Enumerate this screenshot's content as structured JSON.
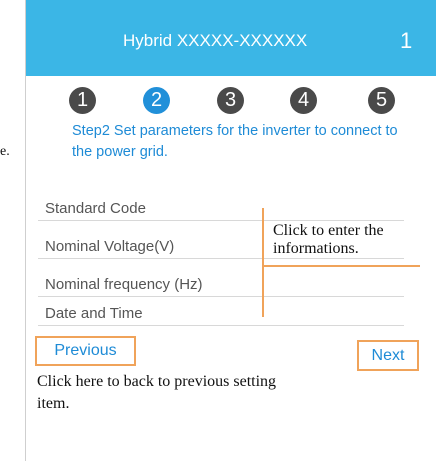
{
  "left_fragment": "e.",
  "header": {
    "title": "Hybrid XXXXX-XXXXXX",
    "page_number": "1"
  },
  "steps": [
    {
      "label": "1",
      "active": false
    },
    {
      "label": "2",
      "active": true
    },
    {
      "label": "3",
      "active": false
    },
    {
      "label": "4",
      "active": false
    },
    {
      "label": "5",
      "active": false
    }
  ],
  "instruction": "Step2 Set parameters for the inverter to connect to the power grid.",
  "parameters": [
    {
      "label": "Standard Code"
    },
    {
      "label": "Nominal Voltage(V)"
    },
    {
      "label": "Nominal frequency (Hz)"
    },
    {
      "label": "Date and Time"
    }
  ],
  "annotations": {
    "enter_info": "Click to enter the informations.",
    "back_info": "Click here to back to previous setting item."
  },
  "buttons": {
    "previous": "Previous",
    "next": "Next"
  },
  "colors": {
    "header": "#3bb6e6",
    "accent_blue": "#1e8bd6",
    "step_active": "#2190d9",
    "step_inactive": "#4a4a4a",
    "annotation": "#f0a35a"
  }
}
